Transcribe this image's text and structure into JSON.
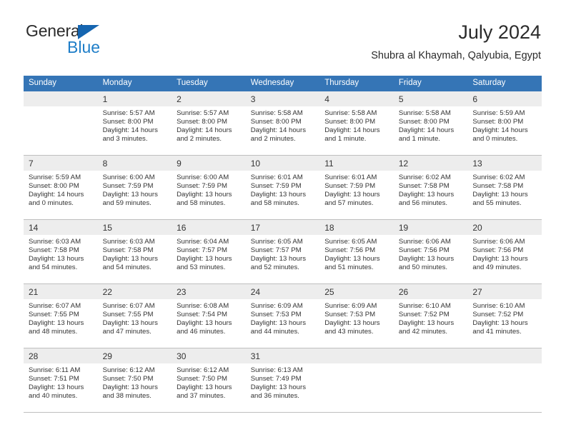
{
  "brand": {
    "word_general": "General",
    "word_blue": "Blue",
    "triangle_color": "#1565b0",
    "blue_color": "#1f7ec8"
  },
  "header": {
    "title": "July 2024",
    "subtitle": "Shubra al Khaymah, Qalyubia, Egypt"
  },
  "theme": {
    "header_row_bg": "#3575b6",
    "header_row_text": "#ffffff",
    "shaded_row_bg": "#ededed",
    "grid_line": "#bfbfbf",
    "text": "#333333"
  },
  "columns": [
    "Sunday",
    "Monday",
    "Tuesday",
    "Wednesday",
    "Thursday",
    "Friday",
    "Saturday"
  ],
  "weeks": [
    {
      "shaded": true,
      "days": [
        {
          "num": "",
          "detail": ""
        },
        {
          "num": "1",
          "detail": "Sunrise: 5:57 AM\nSunset: 8:00 PM\nDaylight: 14 hours\nand 3 minutes."
        },
        {
          "num": "2",
          "detail": "Sunrise: 5:57 AM\nSunset: 8:00 PM\nDaylight: 14 hours\nand 2 minutes."
        },
        {
          "num": "3",
          "detail": "Sunrise: 5:58 AM\nSunset: 8:00 PM\nDaylight: 14 hours\nand 2 minutes."
        },
        {
          "num": "4",
          "detail": "Sunrise: 5:58 AM\nSunset: 8:00 PM\nDaylight: 14 hours\nand 1 minute."
        },
        {
          "num": "5",
          "detail": "Sunrise: 5:58 AM\nSunset: 8:00 PM\nDaylight: 14 hours\nand 1 minute."
        },
        {
          "num": "6",
          "detail": "Sunrise: 5:59 AM\nSunset: 8:00 PM\nDaylight: 14 hours\nand 0 minutes."
        }
      ]
    },
    {
      "shaded": true,
      "days": [
        {
          "num": "7",
          "detail": "Sunrise: 5:59 AM\nSunset: 8:00 PM\nDaylight: 14 hours\nand 0 minutes."
        },
        {
          "num": "8",
          "detail": "Sunrise: 6:00 AM\nSunset: 7:59 PM\nDaylight: 13 hours\nand 59 minutes."
        },
        {
          "num": "9",
          "detail": "Sunrise: 6:00 AM\nSunset: 7:59 PM\nDaylight: 13 hours\nand 58 minutes."
        },
        {
          "num": "10",
          "detail": "Sunrise: 6:01 AM\nSunset: 7:59 PM\nDaylight: 13 hours\nand 58 minutes."
        },
        {
          "num": "11",
          "detail": "Sunrise: 6:01 AM\nSunset: 7:59 PM\nDaylight: 13 hours\nand 57 minutes."
        },
        {
          "num": "12",
          "detail": "Sunrise: 6:02 AM\nSunset: 7:58 PM\nDaylight: 13 hours\nand 56 minutes."
        },
        {
          "num": "13",
          "detail": "Sunrise: 6:02 AM\nSunset: 7:58 PM\nDaylight: 13 hours\nand 55 minutes."
        }
      ]
    },
    {
      "shaded": true,
      "days": [
        {
          "num": "14",
          "detail": "Sunrise: 6:03 AM\nSunset: 7:58 PM\nDaylight: 13 hours\nand 54 minutes."
        },
        {
          "num": "15",
          "detail": "Sunrise: 6:03 AM\nSunset: 7:58 PM\nDaylight: 13 hours\nand 54 minutes."
        },
        {
          "num": "16",
          "detail": "Sunrise: 6:04 AM\nSunset: 7:57 PM\nDaylight: 13 hours\nand 53 minutes."
        },
        {
          "num": "17",
          "detail": "Sunrise: 6:05 AM\nSunset: 7:57 PM\nDaylight: 13 hours\nand 52 minutes."
        },
        {
          "num": "18",
          "detail": "Sunrise: 6:05 AM\nSunset: 7:56 PM\nDaylight: 13 hours\nand 51 minutes."
        },
        {
          "num": "19",
          "detail": "Sunrise: 6:06 AM\nSunset: 7:56 PM\nDaylight: 13 hours\nand 50 minutes."
        },
        {
          "num": "20",
          "detail": "Sunrise: 6:06 AM\nSunset: 7:56 PM\nDaylight: 13 hours\nand 49 minutes."
        }
      ]
    },
    {
      "shaded": true,
      "days": [
        {
          "num": "21",
          "detail": "Sunrise: 6:07 AM\nSunset: 7:55 PM\nDaylight: 13 hours\nand 48 minutes."
        },
        {
          "num": "22",
          "detail": "Sunrise: 6:07 AM\nSunset: 7:55 PM\nDaylight: 13 hours\nand 47 minutes."
        },
        {
          "num": "23",
          "detail": "Sunrise: 6:08 AM\nSunset: 7:54 PM\nDaylight: 13 hours\nand 46 minutes."
        },
        {
          "num": "24",
          "detail": "Sunrise: 6:09 AM\nSunset: 7:53 PM\nDaylight: 13 hours\nand 44 minutes."
        },
        {
          "num": "25",
          "detail": "Sunrise: 6:09 AM\nSunset: 7:53 PM\nDaylight: 13 hours\nand 43 minutes."
        },
        {
          "num": "26",
          "detail": "Sunrise: 6:10 AM\nSunset: 7:52 PM\nDaylight: 13 hours\nand 42 minutes."
        },
        {
          "num": "27",
          "detail": "Sunrise: 6:10 AM\nSunset: 7:52 PM\nDaylight: 13 hours\nand 41 minutes."
        }
      ]
    },
    {
      "shaded": true,
      "days": [
        {
          "num": "28",
          "detail": "Sunrise: 6:11 AM\nSunset: 7:51 PM\nDaylight: 13 hours\nand 40 minutes."
        },
        {
          "num": "29",
          "detail": "Sunrise: 6:12 AM\nSunset: 7:50 PM\nDaylight: 13 hours\nand 38 minutes."
        },
        {
          "num": "30",
          "detail": "Sunrise: 6:12 AM\nSunset: 7:50 PM\nDaylight: 13 hours\nand 37 minutes."
        },
        {
          "num": "31",
          "detail": "Sunrise: 6:13 AM\nSunset: 7:49 PM\nDaylight: 13 hours\nand 36 minutes."
        },
        {
          "num": "",
          "detail": ""
        },
        {
          "num": "",
          "detail": ""
        },
        {
          "num": "",
          "detail": ""
        }
      ]
    }
  ]
}
